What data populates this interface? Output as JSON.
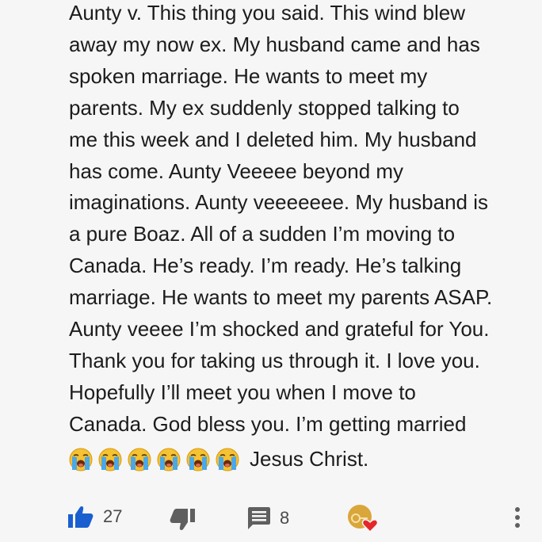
{
  "comment": {
    "lines": [
      "Aunty v. This thing you said. This wind blew",
      "away my now ex.  My husband came and has",
      "spoken marriage. He wants to meet my",
      "parents. My ex suddenly stopped talking to",
      "me this week and I deleted him. My husband",
      "has come. Aunty Veeeee beyond my",
      "imaginations. Aunty veeeeeee. My husband is",
      "a pure Boaz. All of a sudden I’m moving to",
      "Canada. He’s ready. I’m ready. He’s talking",
      "marriage. He wants to meet my parents ASAP.",
      "Aunty veeee I’m shocked and grateful for You.",
      "Thank you for taking us through it. I love you.",
      "Hopefully I’ll meet you when I move to",
      "Canada. God bless you. I’m getting married"
    ],
    "emoji_count": 6,
    "emoji_name": "loudly-crying-face-icon",
    "closing_text": "Jesus Christ."
  },
  "actions": {
    "like_count": "27",
    "reply_count": "8"
  },
  "colors": {
    "background": "#f6f6f6",
    "text": "#1c1c1c",
    "like_blue": "#1a5fd0",
    "icon_gray": "#5f5f5f",
    "heart_red": "#e5262a",
    "avatar_gold": "#d9a63a"
  }
}
